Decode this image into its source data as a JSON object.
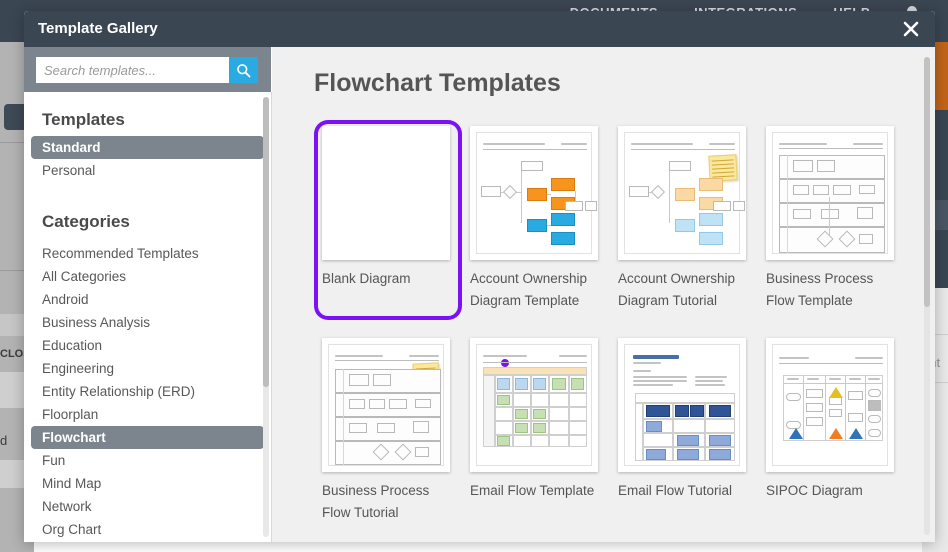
{
  "background": {
    "nav_items": [
      "DOCUMENTS",
      "INTEGRATIONS",
      "HELP"
    ],
    "bell_icon": "bell-icon",
    "left_close_text": "CLOS",
    "left_d_text": "d",
    "right_label_text": "ent"
  },
  "modal": {
    "title": "Template Gallery",
    "close_icon": "close-icon"
  },
  "search": {
    "placeholder": "Search templates...",
    "value": "",
    "button_icon": "search-icon",
    "button_color": "#29abe2"
  },
  "sidebar": {
    "templates_heading": "Templates",
    "template_scopes": [
      {
        "label": "Standard",
        "active": true
      },
      {
        "label": "Personal",
        "active": false
      }
    ],
    "categories_heading": "Categories",
    "categories": [
      {
        "label": "Recommended Templates",
        "active": false
      },
      {
        "label": "All Categories",
        "active": false
      },
      {
        "label": "Android",
        "active": false
      },
      {
        "label": "Business Analysis",
        "active": false
      },
      {
        "label": "Education",
        "active": false
      },
      {
        "label": "Engineering",
        "active": false
      },
      {
        "label": "Entity Relationship (ERD)",
        "active": false
      },
      {
        "label": "Floorplan",
        "active": false
      },
      {
        "label": "Flowchart",
        "active": true
      },
      {
        "label": "Fun",
        "active": false
      },
      {
        "label": "Mind Map",
        "active": false
      },
      {
        "label": "Network",
        "active": false
      },
      {
        "label": "Org Chart",
        "active": false
      }
    ]
  },
  "main": {
    "title": "Flowchart Templates",
    "selection_color": "#7b12f5",
    "templates": [
      {
        "label": "Blank Diagram",
        "art": "blank",
        "selected": true
      },
      {
        "label": "Account Ownership Diagram Template",
        "art": "account-template",
        "selected": false
      },
      {
        "label": "Account Ownership Diagram Tutorial",
        "art": "account-tutorial",
        "selected": false
      },
      {
        "label": "Business Process Flow Template",
        "art": "bpf-template",
        "selected": false
      },
      {
        "label": "Business Process Flow Tutorial",
        "art": "bpf-tutorial",
        "selected": false
      },
      {
        "label": "Email Flow Template",
        "art": "email-template",
        "selected": false
      },
      {
        "label": "Email Flow Tutorial",
        "art": "email-tutorial",
        "selected": false
      },
      {
        "label": "SIPOC Diagram",
        "art": "sipoc",
        "selected": false
      }
    ]
  }
}
